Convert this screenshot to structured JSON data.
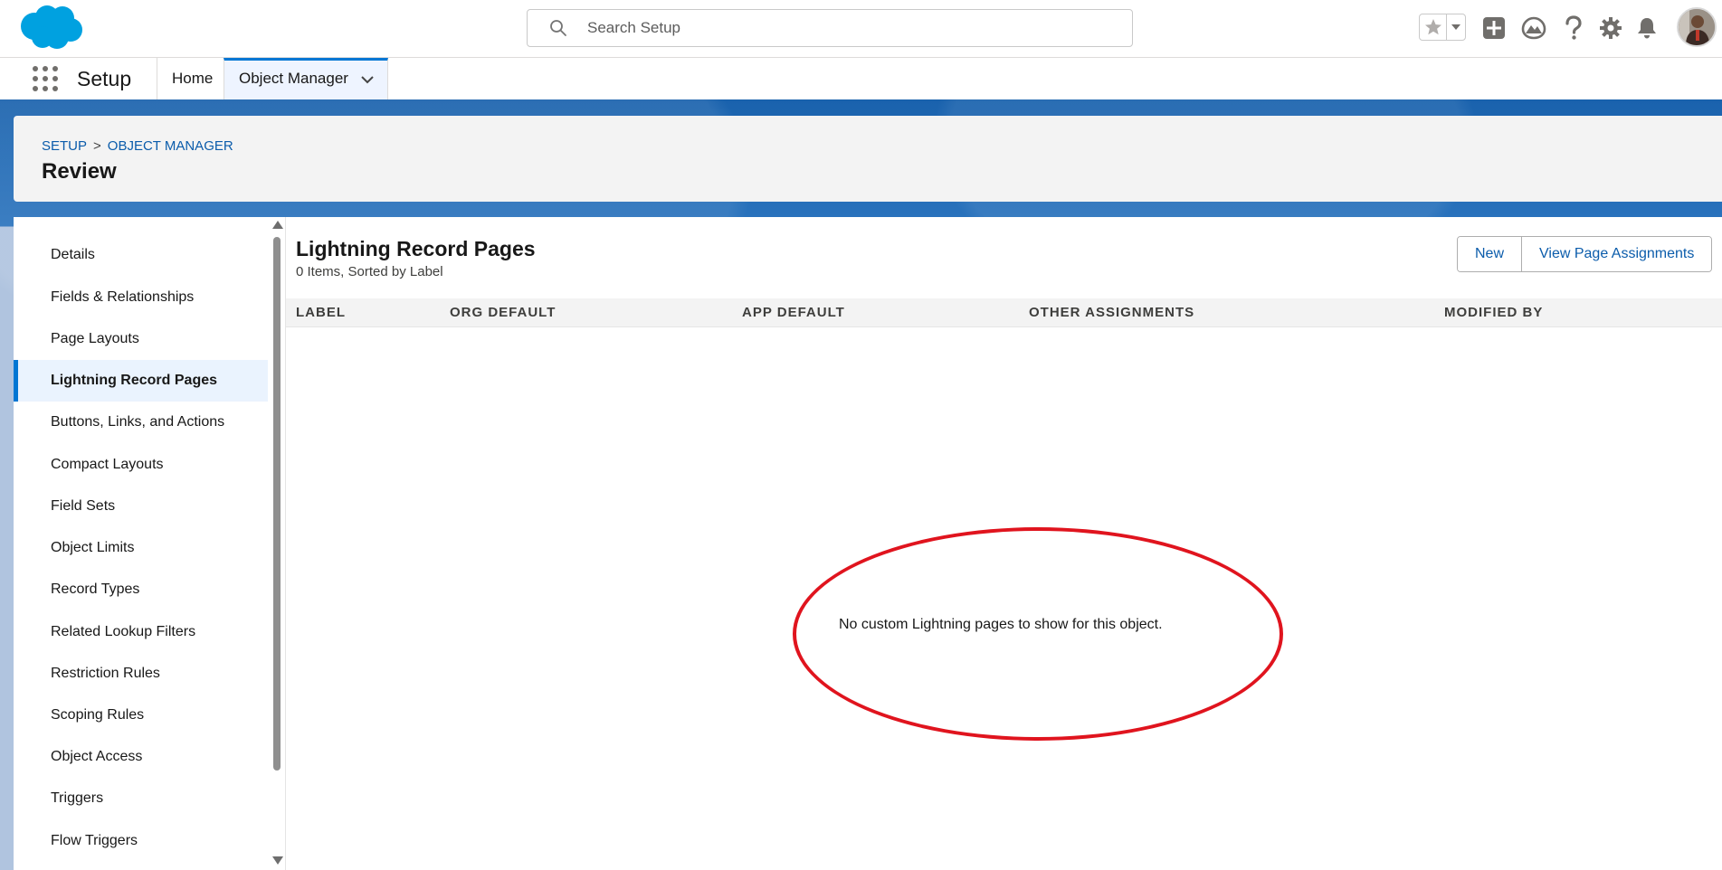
{
  "header": {
    "search": {
      "placeholder": "Search Setup"
    },
    "icons": [
      "salesforce-logo",
      "search-icon",
      "star-icon",
      "chevron-down-icon",
      "plus-icon",
      "trailhead-icon",
      "help-icon",
      "gear-icon",
      "bell-icon",
      "avatar"
    ]
  },
  "context_bar": {
    "app_name": "Setup",
    "tabs": [
      {
        "label": "Home"
      },
      {
        "label": "Object Manager"
      }
    ]
  },
  "page_header": {
    "breadcrumb": [
      "SETUP",
      "OBJECT MANAGER"
    ],
    "breadcrumb_separator": ">",
    "title": "Review"
  },
  "sidenav": {
    "items": [
      {
        "label": "Details"
      },
      {
        "label": "Fields & Relationships"
      },
      {
        "label": "Page Layouts"
      },
      {
        "label": "Lightning Record Pages"
      },
      {
        "label": "Buttons, Links, and Actions"
      },
      {
        "label": "Compact Layouts"
      },
      {
        "label": "Field Sets"
      },
      {
        "label": "Object Limits"
      },
      {
        "label": "Record Types"
      },
      {
        "label": "Related Lookup Filters"
      },
      {
        "label": "Restriction Rules"
      },
      {
        "label": "Scoping Rules"
      },
      {
        "label": "Object Access"
      },
      {
        "label": "Triggers"
      },
      {
        "label": "Flow Triggers"
      }
    ],
    "active": "Lightning Record Pages"
  },
  "content": {
    "title": "Lightning Record Pages",
    "subtitle": "0 Items, Sorted by Label",
    "buttons": {
      "new": "New",
      "view_assignments": "View Page Assignments"
    },
    "columns": [
      "LABEL",
      "ORG DEFAULT",
      "APP DEFAULT",
      "OTHER ASSIGNMENTS",
      "MODIFIED BY"
    ],
    "empty_message": "No custom Lightning pages to show for this object."
  },
  "colors": {
    "brand_blue": "#0176d3",
    "link_blue": "#0b5cab",
    "annotation_red": "#e0141e",
    "logo_blue": "#00a1e0"
  }
}
